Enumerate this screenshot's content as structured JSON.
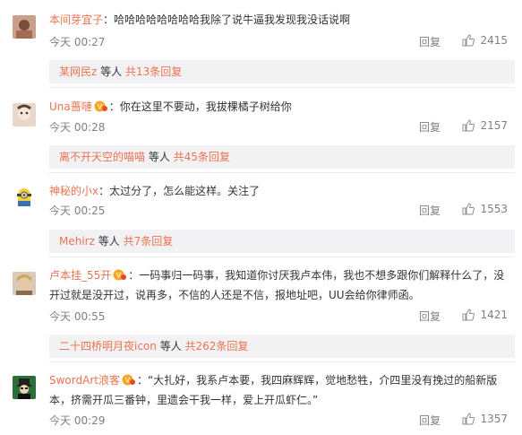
{
  "comments": [
    {
      "username": "本间芽宜子",
      "text": "：哈哈哈哈哈哈哈哈我除了说牛逼我发现我没话说啊",
      "time": "今天 00:27",
      "reply_label": "回复",
      "likes": "2415",
      "sub": {
        "users": "某网民z",
        "middle": " 等人 ",
        "more": "共13条回复"
      }
    },
    {
      "username": "Una蔷嗹",
      "text": "：你在这里不要动，我拔棵橘子树给你",
      "time": "今天 00:28",
      "reply_label": "回复",
      "likes": "2157",
      "sub": {
        "users": "离不开天空的喵喵",
        "middle": " 等人 ",
        "more": "共45条回复"
      }
    },
    {
      "username": "神秘的小x",
      "text": "：太过分了，怎么能这样。关注了",
      "time": "今天 00:25",
      "reply_label": "回复",
      "likes": "1553",
      "sub": {
        "users": "Mehirz",
        "middle": " 等人 ",
        "more": "共7条回复"
      }
    },
    {
      "username": "卢本挂_55开",
      "text": "：一码事归一码事，我知道你讨厌我卢本伟，我也不想多跟你们解释什么了，没开过就是没开过，说再多，不信的人还是不信，报地址吧，UU会给你律师函。",
      "time": "今天 00:55",
      "reply_label": "回复",
      "likes": "1421",
      "sub": {
        "users": "二十四桥明月夜icon",
        "middle": " 等人 ",
        "more": "共262条回复"
      }
    },
    {
      "username": "SwordArt浪客",
      "text": "：“大扎好，我系卢本要，我四麻辉辉，觉地愁牲，介四里没有挽过的船新版本，挤需开瓜三番钟，里遗会干我一样，爱上开瓜虾仁。”",
      "time": "今天 00:29",
      "reply_label": "回复",
      "likes": "1357"
    }
  ],
  "colors": {
    "link": "#eb7350",
    "meta": "#808080",
    "subbox_bg": "#f2f2f5"
  },
  "icons": {
    "like": "thumbs-up-icon",
    "badge": "vip-badge-icon"
  }
}
